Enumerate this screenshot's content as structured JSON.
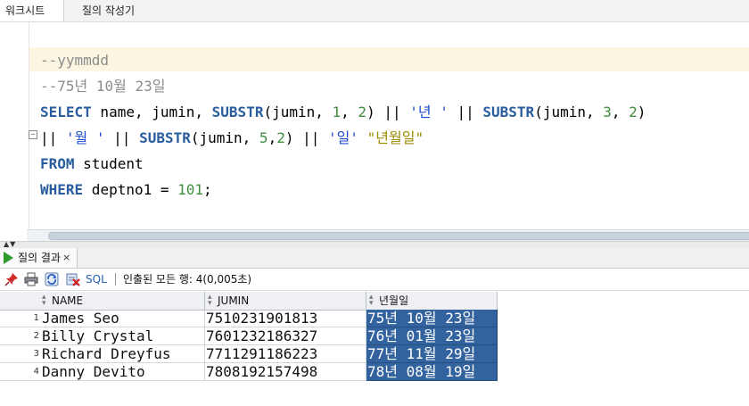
{
  "tabs": {
    "worksheet": "워크시트",
    "query_builder": "질의 작성기"
  },
  "editor": {
    "lines": [
      {
        "type": "comment",
        "text": "--yymmdd"
      },
      {
        "type": "comment",
        "text": "--75년 10월 23일"
      },
      {
        "type": "sql",
        "tokens": [
          {
            "k": "kw",
            "t": "SELECT"
          },
          {
            "k": "p",
            "t": " name, jumin, "
          },
          {
            "k": "kw",
            "t": "SUBSTR"
          },
          {
            "k": "p",
            "t": "(jumin, "
          },
          {
            "k": "num",
            "t": "1"
          },
          {
            "k": "p",
            "t": ", "
          },
          {
            "k": "num",
            "t": "2"
          },
          {
            "k": "p",
            "t": ") || "
          },
          {
            "k": "st",
            "t": "'년 '"
          },
          {
            "k": "p",
            "t": " || "
          },
          {
            "k": "kw",
            "t": "SUBSTR"
          },
          {
            "k": "p",
            "t": "(jumin, "
          },
          {
            "k": "num",
            "t": "3"
          },
          {
            "k": "p",
            "t": ", "
          },
          {
            "k": "num",
            "t": "2"
          },
          {
            "k": "p",
            "t": ")"
          }
        ]
      },
      {
        "type": "sql",
        "tokens": [
          {
            "k": "p",
            "t": "|| "
          },
          {
            "k": "st",
            "t": "'월 '"
          },
          {
            "k": "p",
            "t": " || "
          },
          {
            "k": "kw",
            "t": "SUBSTR"
          },
          {
            "k": "p",
            "t": "(jumin, "
          },
          {
            "k": "num",
            "t": "5"
          },
          {
            "k": "p",
            "t": ","
          },
          {
            "k": "num",
            "t": "2"
          },
          {
            "k": "p",
            "t": ") || "
          },
          {
            "k": "st",
            "t": "'일'"
          },
          {
            "k": "p",
            "t": " "
          },
          {
            "k": "dq",
            "t": "\"년월일\""
          }
        ]
      },
      {
        "type": "sql",
        "tokens": [
          {
            "k": "kw",
            "t": "FROM"
          },
          {
            "k": "p",
            "t": " student"
          }
        ]
      },
      {
        "type": "sql",
        "tokens": [
          {
            "k": "kw",
            "t": "WHERE"
          },
          {
            "k": "p",
            "t": " deptno1 = "
          },
          {
            "k": "num",
            "t": "101"
          },
          {
            "k": "p",
            "t": ";"
          }
        ]
      }
    ]
  },
  "results": {
    "tab_label": "질의 결과",
    "close_glyph": "×",
    "toolbar": {
      "sql_label": "SQL",
      "status": "인출된 모든 행: 4(0,005초)"
    },
    "columns": [
      "NAME",
      "JUMIN",
      "년월일"
    ],
    "rows": [
      {
        "num": "1",
        "name": "James Seo",
        "jumin": "7510231901813",
        "date": "75년 10월 23일"
      },
      {
        "num": "2",
        "name": "Billy Crystal",
        "jumin": "7601232186327",
        "date": "76년 01월 23일"
      },
      {
        "num": "3",
        "name": "Richard Dreyfus",
        "jumin": "7711291186223",
        "date": "77년 11월 29일"
      },
      {
        "num": "4",
        "name": "Danny Devito",
        "jumin": "7808192157498",
        "date": "78년 08월 19일"
      }
    ]
  },
  "colors": {
    "keyword": "#2a5d9f",
    "comment": "#8c8c8c",
    "string": "#1e4bd1",
    "number": "#3e8e3e",
    "alias": "#9a8a00",
    "selection": "#33639f"
  }
}
